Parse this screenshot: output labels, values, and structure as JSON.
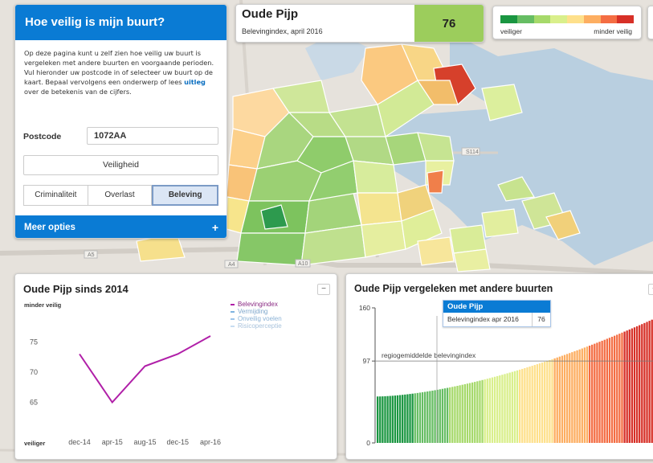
{
  "control": {
    "title": "Hoe veilig is mijn buurt?",
    "intro_text": "Op deze pagina kunt u zelf zien hoe veilig uw buurt is vergeleken met andere buurten en voorgaande perioden. Vul hieronder uw postcode in of selecteer uw buurt op de kaart. Bepaal vervolgens een onderwerp of lees ",
    "intro_link": "uitleg",
    "intro_tail": " over de betekenis van de cijfers.",
    "postcode_label": "Postcode",
    "postcode_value": "1072AA",
    "theme_button": "Veiligheid",
    "tabs": [
      "Criminaliteit",
      "Overlast",
      "Beleving"
    ],
    "active_tab": "Beleving",
    "more_options": "Meer opties",
    "more_icon": "+"
  },
  "area": {
    "name": "Oude Pijp",
    "subtitle": "Belevingindex, april 2016",
    "score": "76",
    "score_color": "#9ccd5c"
  },
  "legend": {
    "colors": [
      "#1a9641",
      "#66bd63",
      "#a6d96a",
      "#d9ef8b",
      "#fee08b",
      "#fdae61",
      "#f46d43",
      "#d73027"
    ],
    "left_label": "veiliger",
    "right_label": "minder veilig"
  },
  "trend": {
    "title": "Oude Pijp sinds 2014",
    "top_label": "minder veilig",
    "bottom_label": "veiliger",
    "collapse_icon": "−",
    "legend": [
      {
        "name": "Belevingindex",
        "color": "#b01fa8"
      },
      {
        "name": "Vermijding",
        "color": "#7eb3e0"
      },
      {
        "name": "Onveilig voelen",
        "color": "#9cc5ea"
      },
      {
        "name": "Risicoperceptie",
        "color": "#c7ddf2"
      }
    ]
  },
  "compare": {
    "title": "Oude Pijp vergeleken met andere buurten",
    "collapse_icon": "−",
    "tooltip_title": "Oude Pijp",
    "tooltip_label": "Belevingindex apr 2016",
    "tooltip_value": "76",
    "avg_label": "regiogemiddelde belevingindex"
  },
  "chart_data": [
    {
      "type": "line",
      "title": "Oude Pijp sinds 2014",
      "x": [
        "dec-14",
        "apr-15",
        "aug-15",
        "dec-15",
        "apr-16"
      ],
      "series": [
        {
          "name": "Belevingindex",
          "values": [
            73,
            65,
            71,
            73,
            76
          ]
        }
      ],
      "yticks": [
        65,
        70,
        75
      ],
      "ylim": [
        62,
        78
      ],
      "grid": false
    },
    {
      "type": "bar",
      "title": "Oude Pijp vergeleken met andere buurten",
      "yticks": [
        0,
        97,
        160
      ],
      "ylim": [
        0,
        160
      ],
      "reference_line": {
        "label": "regiogemiddelde belevingindex",
        "value": 97
      },
      "highlight": {
        "name": "Oude Pijp",
        "value": 76
      },
      "bar_count": 114,
      "value_range": [
        55,
        150
      ],
      "grid": false
    }
  ]
}
